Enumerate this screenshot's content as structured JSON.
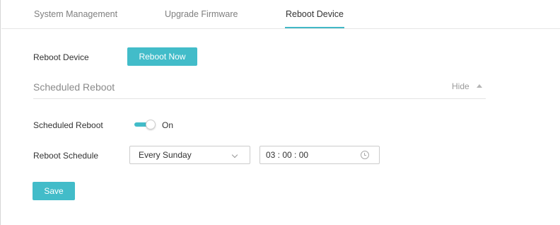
{
  "tabs": [
    {
      "label": "System Management",
      "active": false
    },
    {
      "label": "Upgrade Firmware",
      "active": false
    },
    {
      "label": "Reboot Device",
      "active": true
    }
  ],
  "reboot": {
    "label": "Reboot Device",
    "button_label": "Reboot Now"
  },
  "scheduled_section": {
    "title": "Scheduled Reboot",
    "toggle_label": "Hide"
  },
  "scheduled": {
    "label": "Scheduled Reboot",
    "switch_state": "On",
    "enabled": true
  },
  "schedule": {
    "label": "Reboot Schedule",
    "selected_option": "Every Sunday",
    "time_value": "03 : 00 : 00"
  },
  "save_label": "Save",
  "colors": {
    "accent": "#42bcc9",
    "border": "#cccccc"
  },
  "icons": {
    "hide": "chevron-up-icon",
    "select": "chevron-down-icon",
    "time": "clock-icon"
  }
}
